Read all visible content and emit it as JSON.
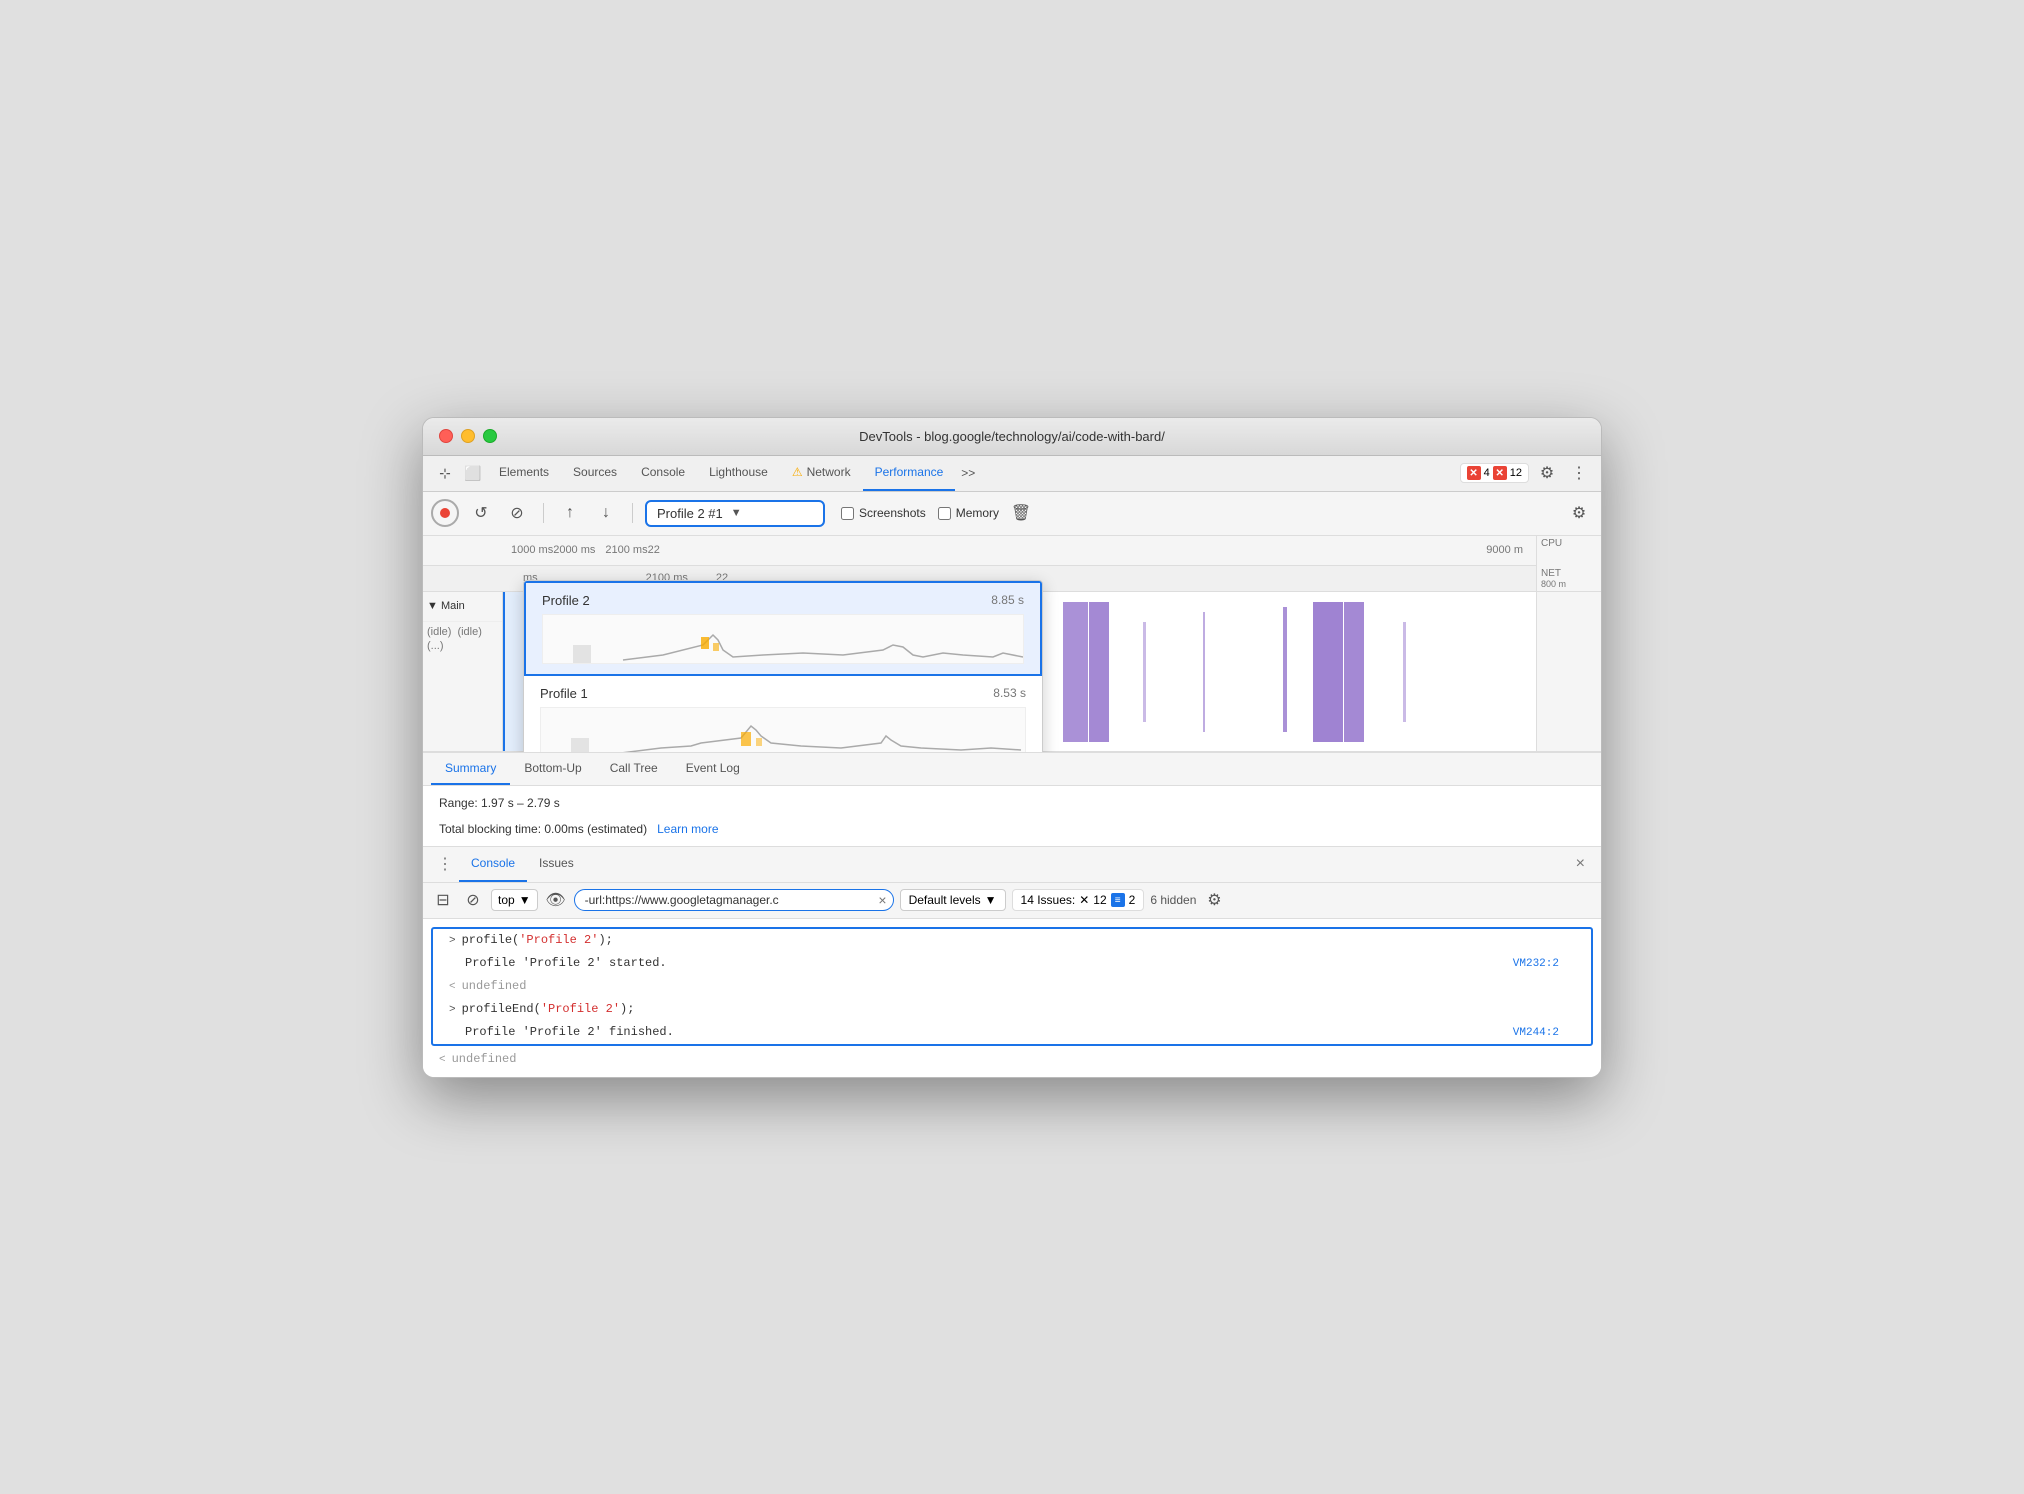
{
  "window": {
    "title": "DevTools - blog.google/technology/ai/code-with-bard/"
  },
  "toolbar": {
    "elements_label": "Elements",
    "sources_label": "Sources",
    "console_label": "Console",
    "lighthouse_label": "Lighthouse",
    "network_label": "Network",
    "performance_label": "Performance",
    "overflow_label": ">>",
    "errors_count": "4",
    "warnings_count": "12"
  },
  "perf_toolbar": {
    "profile_label": "Profile 2 #1",
    "screenshots_label": "Screenshots",
    "memory_label": "Memory"
  },
  "timeline": {
    "ruler_marks": [
      "1000 ms",
      "2000 ms",
      "2100 ms",
      "22",
      "9000 m"
    ],
    "second_row_marks": [
      "ms",
      "2100 ms",
      "22"
    ],
    "cpu_label": "CPU",
    "net_label": "NET",
    "net_val": "800 m",
    "main_label": "▼ Main",
    "idle1": "(idle)",
    "idle2": "(idle)",
    "ellipsis": "(...)"
  },
  "dropdown": {
    "profile2_label": "Profile 2",
    "profile2_time": "8.85 s",
    "profile1_label": "Profile 1",
    "profile1_time": "8.53 s"
  },
  "summary": {
    "tabs": [
      "Summary",
      "Bottom-Up",
      "Call Tree",
      "Event Log"
    ],
    "range_label": "Range: 1.97 s – 2.79 s",
    "blocking_label": "Total blocking time: 0.00ms (estimated)",
    "learn_more_label": "Learn more"
  },
  "console_panel": {
    "console_tab": "Console",
    "issues_tab": "Issues",
    "top_label": "top",
    "filter_value": "-url:https://www.googletagmanager.c",
    "levels_label": "Default levels",
    "issues_label": "14 Issues:",
    "issues_errors": "12",
    "issues_info": "2",
    "hidden_label": "6 hidden",
    "line1_arrow": ">",
    "line1_code": "profile(",
    "line1_arg": "'Profile 2'",
    "line1_end": ");",
    "line2": "Profile 'Profile 2' started.",
    "line3_arrow": "<",
    "line3_text": "undefined",
    "line4_arrow": ">",
    "line4_code": "profileEnd(",
    "line4_arg": "'Profile 2'",
    "line4_end": ");",
    "line5": "Profile 'Profile 2' finished.",
    "line6_arrow": "<",
    "line6_text": "undefined",
    "vm_link1": "VM232:2",
    "vm_link2": "VM244:2"
  }
}
